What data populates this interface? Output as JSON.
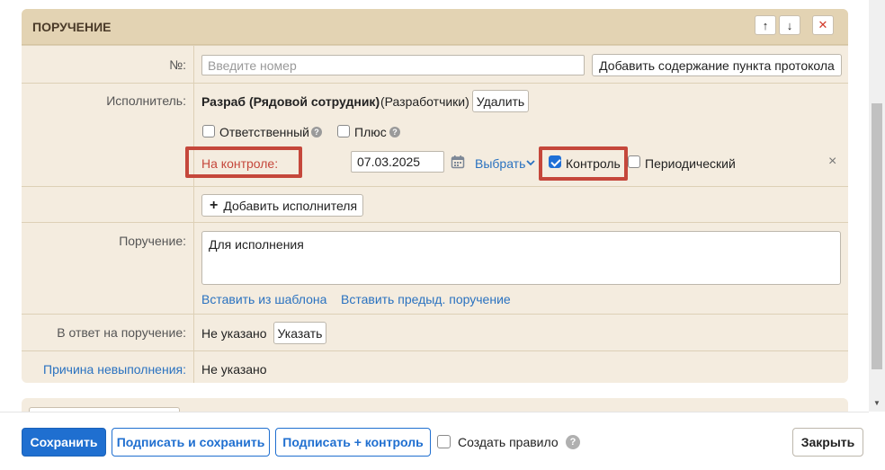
{
  "panel": {
    "title": "ПОРУЧЕНИЕ",
    "move_up_icon": "↑",
    "move_down_icon": "↓",
    "close_icon": "✕"
  },
  "number_row": {
    "label": "№:",
    "placeholder": "Введите номер",
    "add_content_button": "Добавить содержание пункта протокола"
  },
  "executor_row": {
    "label": "Исполнитель:",
    "name": "Разраб (Рядовой сотрудник)",
    "department": "(Разработчики)",
    "delete_button": "Удалить",
    "responsible_label": "Ответственный",
    "plus_label": "Плюс",
    "control_label": "На контроле:",
    "date_value": "07.03.2025",
    "choose_label": "Выбрать",
    "control_checkbox_label": "Контроль",
    "periodic_label": "Периодический",
    "remove_icon": "×"
  },
  "add_executor": {
    "icon": "+",
    "label": "Добавить исполнителя"
  },
  "task_row": {
    "label": "Поручение:",
    "text": "Для исполнения",
    "insert_template": "Вставить из шаблона",
    "insert_previous": "Вставить предыд. поручение"
  },
  "reply_row": {
    "label": "В ответ на поручение:",
    "value": "Не указано",
    "specify_button": "Указать"
  },
  "reason_row": {
    "label": "Причина невыполнения:",
    "value": "Не указано"
  },
  "footer": {
    "save": "Сохранить",
    "sign_save": "Подписать и сохранить",
    "sign_control": "Подписать + контроль",
    "create_rule": "Создать правило",
    "close": "Закрыть"
  },
  "colors": {
    "panel_bg": "#f4ecdf",
    "header_bg": "#e3d3b3",
    "accent": "#1f6fd0",
    "highlight": "#c5473b",
    "link": "#2a72c0"
  }
}
